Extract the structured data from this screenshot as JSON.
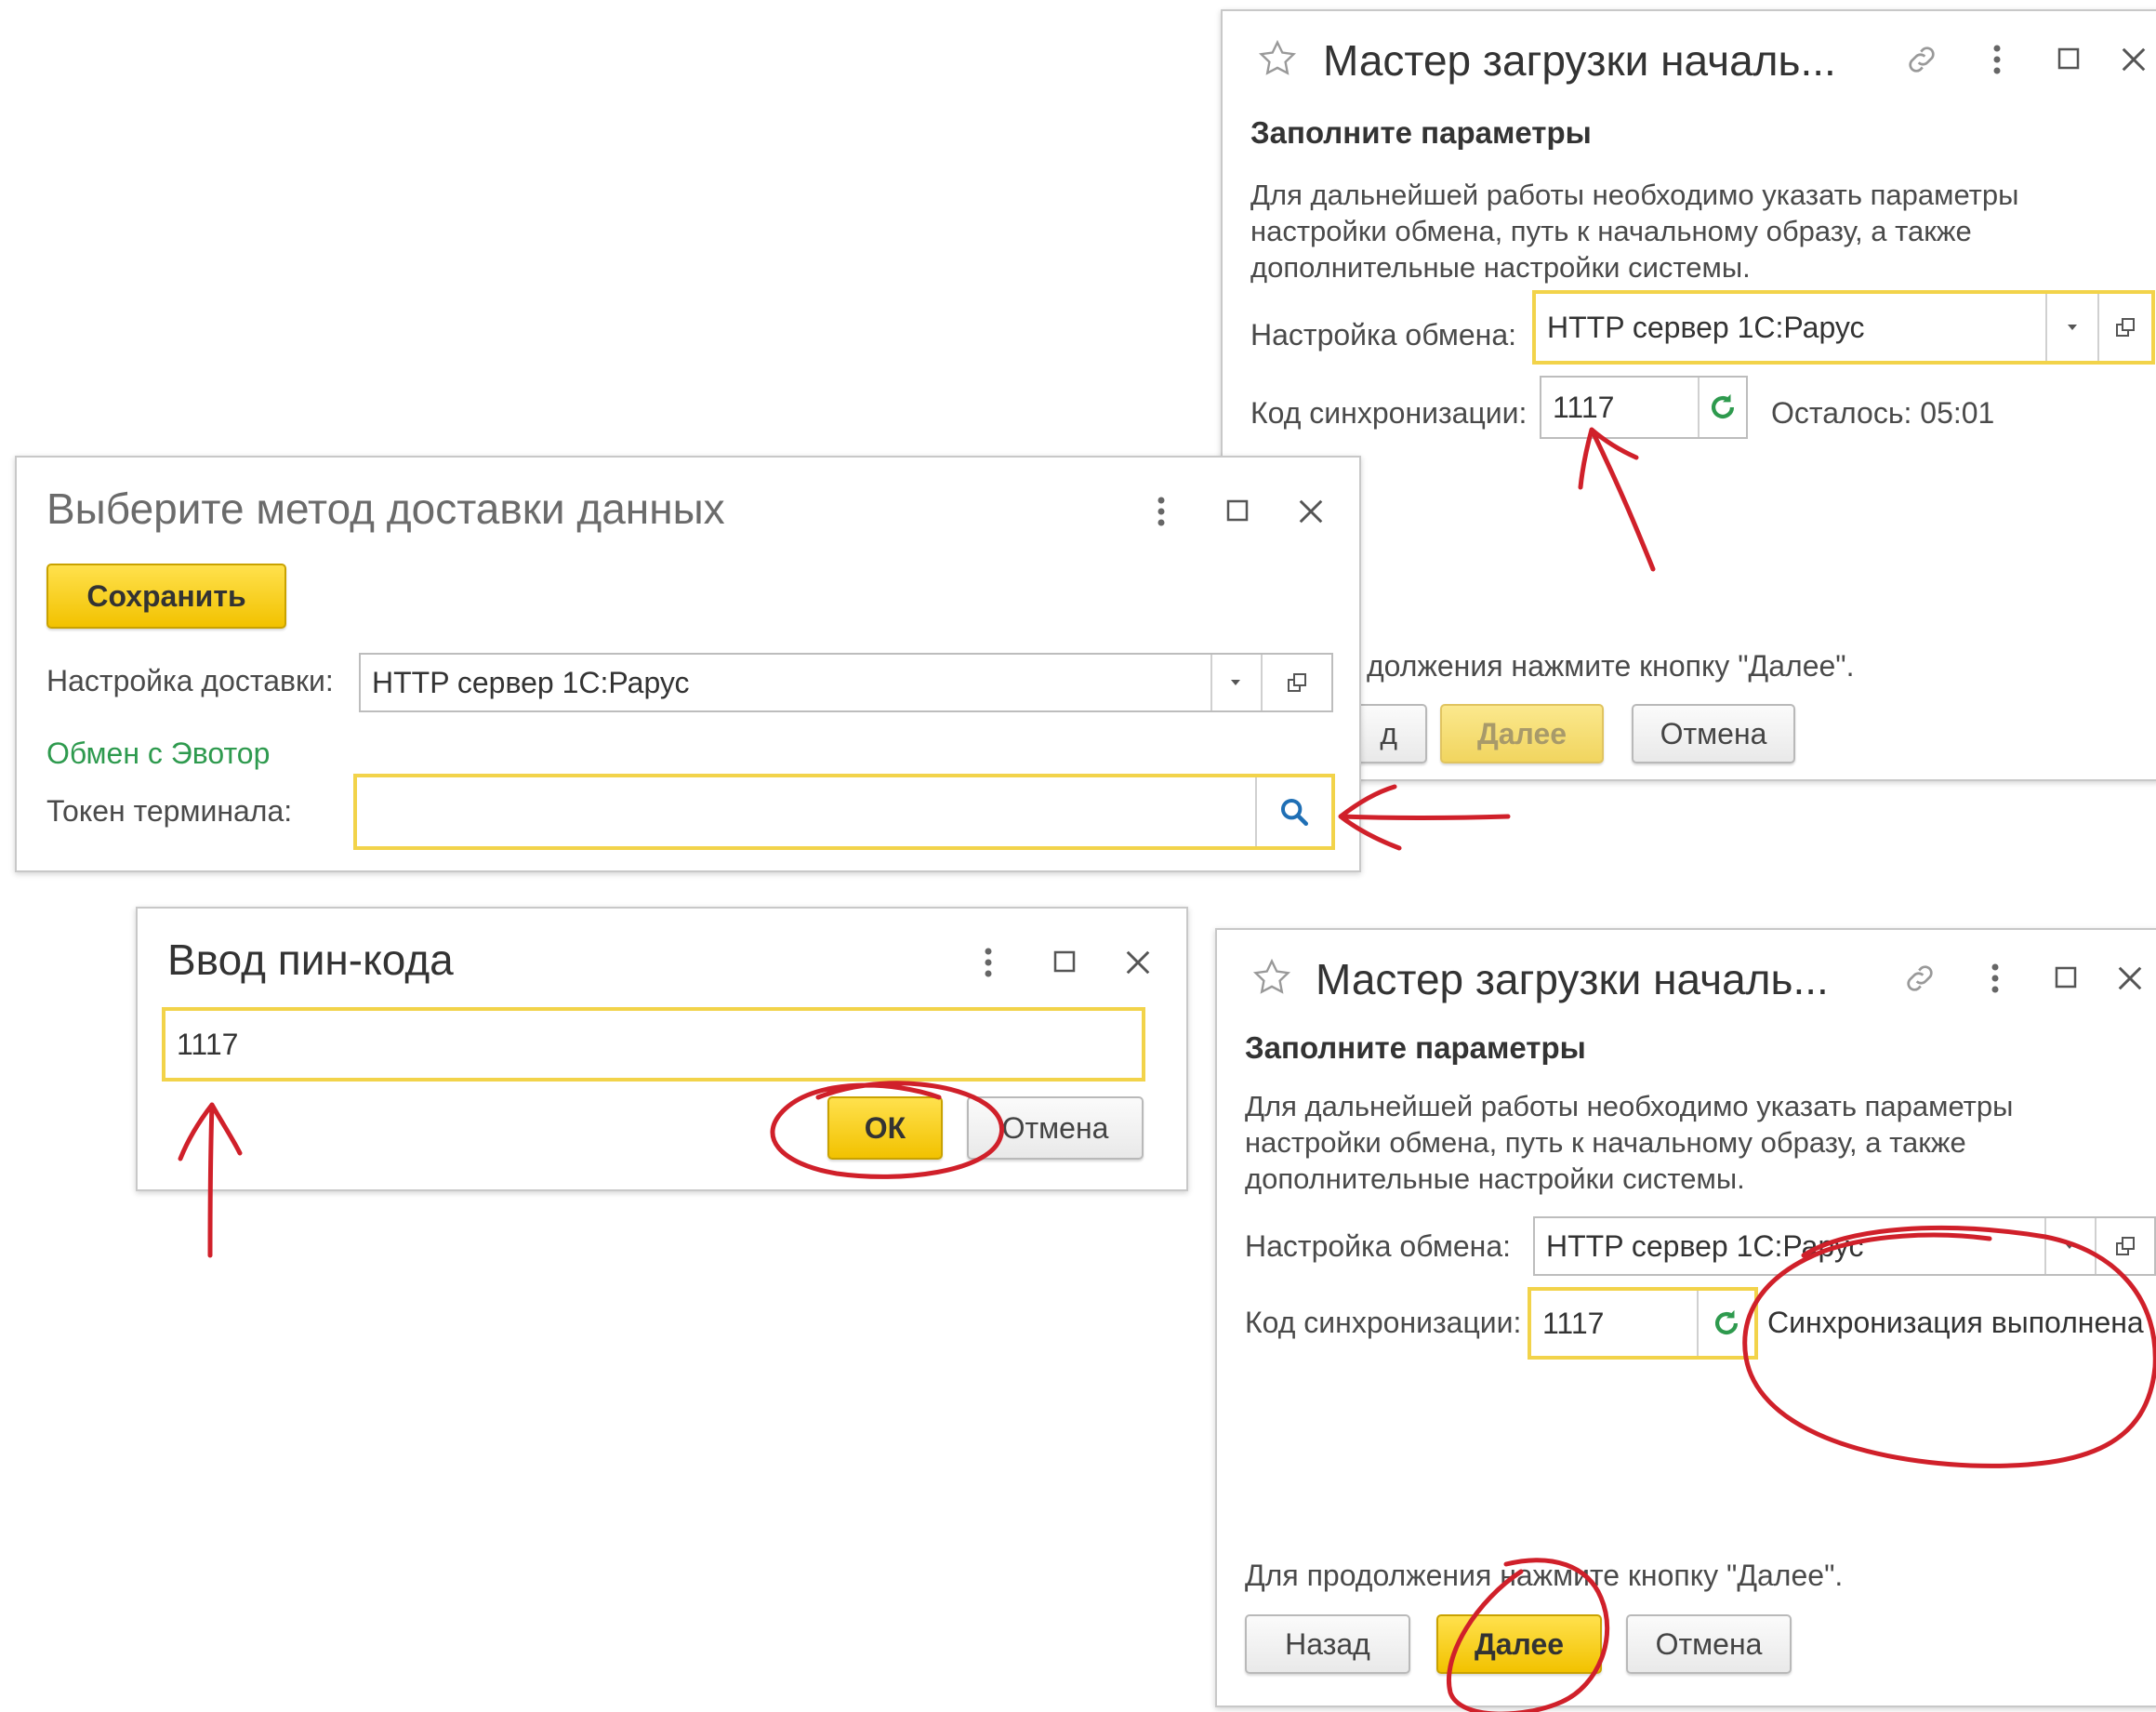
{
  "wizard_top": {
    "title": "Мастер загрузки началь...",
    "section_heading": "Заполните параметры",
    "description": "Для дальнейшей работы необходимо указать параметры настройки обмена, путь к начальному образу, а также дополнительные настройки системы.",
    "exchange_label": "Настройка обмена:",
    "exchange_value": "HTTP сервер 1С:Рарус",
    "sync_label": "Код синхронизации:",
    "sync_value": "1117",
    "remaining": "Осталось: 05:01",
    "continue_hint": "должения нажмите кнопку \"Далее\".",
    "back_label": "д",
    "next_label": "Далее",
    "cancel_label": "Отмена"
  },
  "delivery": {
    "title": "Выберите метод доставки данных",
    "save_label": "Сохранить",
    "delivery_label": "Настройка доставки:",
    "delivery_value": "HTTP сервер 1С:Рарус",
    "evotor_link": "Обмен с Эвотор",
    "token_label": "Токен терминала:",
    "token_value": ""
  },
  "pin": {
    "title": "Ввод пин-кода",
    "pin_value": "1117",
    "ok_label": "ОК",
    "cancel_label": "Отмена"
  },
  "wizard_bottom": {
    "title": "Мастер загрузки началь...",
    "section_heading": "Заполните параметры",
    "description": "Для дальнейшей работы необходимо указать параметры настройки обмена, путь к начальному образу, а также дополнительные настройки системы.",
    "exchange_label": "Настройка обмена:",
    "exchange_value": "HTTP сервер 1С:Рарус",
    "sync_label": "Код синхронизации:",
    "sync_value": "1117",
    "sync_status": "Синхронизация выполнена",
    "continue_hint": "Для продолжения нажмите кнопку \"Далее\".",
    "back_label": "Назад",
    "next_label": "Далее",
    "cancel_label": "Отмена"
  },
  "colors": {
    "accent_yellow": "#f2c200",
    "focus_border": "#f2d34a",
    "link_green": "#2e9a4e",
    "annotation_red": "#d0202a"
  }
}
